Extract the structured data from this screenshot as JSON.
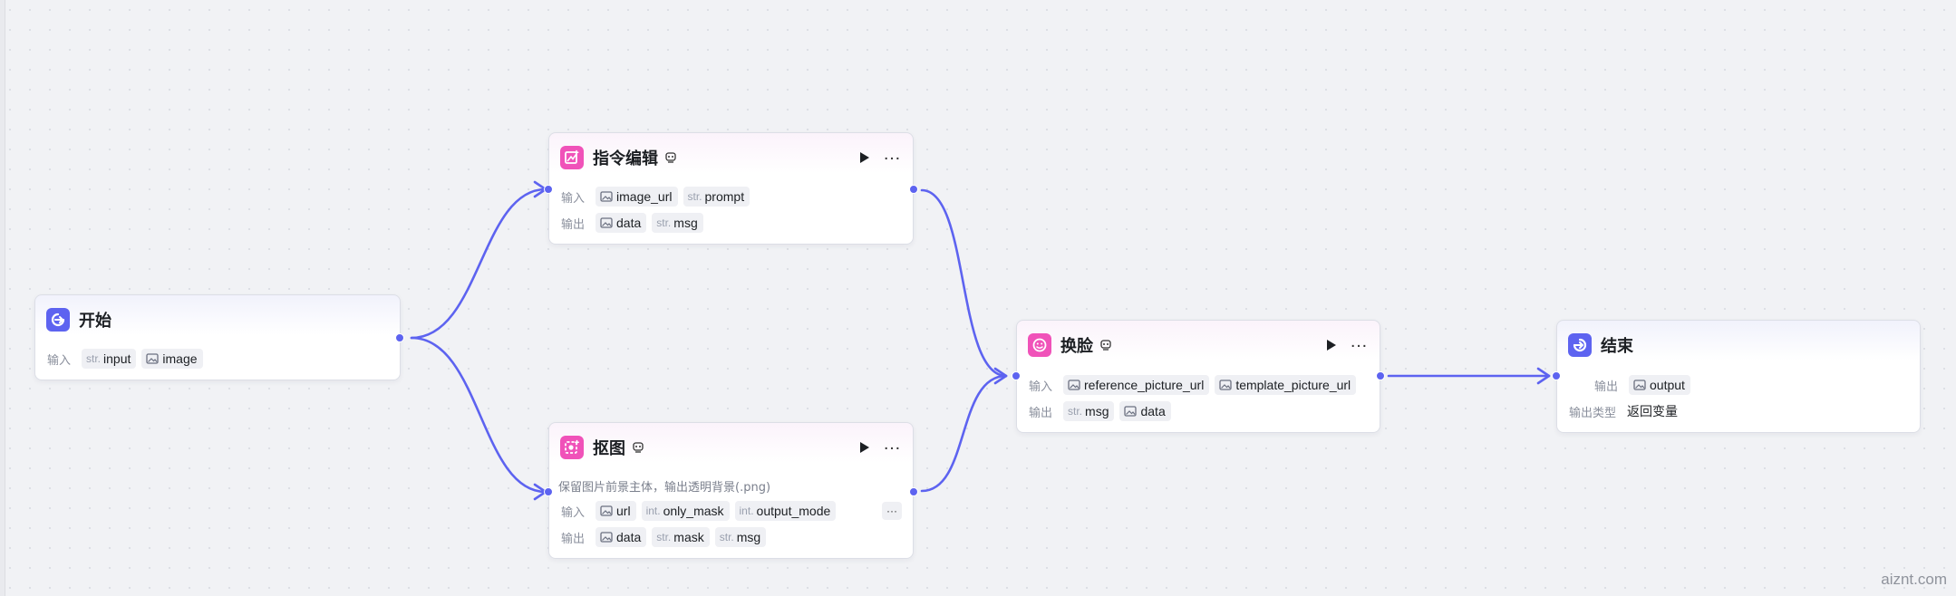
{
  "colors": {
    "accent": "#5d63f0",
    "pink_icon": "#f052b9",
    "canvas": "#f1f2f5"
  },
  "nodes": {
    "start": {
      "title": "开始",
      "icon": "start-icon",
      "input_label": "输入",
      "inputs": [
        {
          "type": "str.",
          "name": "input"
        },
        {
          "type": "image-icon",
          "name": "image"
        }
      ]
    },
    "instruct_edit": {
      "title": "指令编辑",
      "icon": "image-edit-icon",
      "input_label": "输入",
      "output_label": "输出",
      "inputs": [
        {
          "type": "image-icon",
          "name": "image_url"
        },
        {
          "type": "str.",
          "name": "prompt"
        }
      ],
      "outputs": [
        {
          "type": "image-icon",
          "name": "data"
        },
        {
          "type": "str.",
          "name": "msg"
        }
      ]
    },
    "cutout": {
      "title": "抠图",
      "icon": "cutout-icon",
      "description": "保留图片前景主体，输出透明背景(.png)",
      "input_label": "输入",
      "output_label": "输出",
      "inputs": [
        {
          "type": "image-icon",
          "name": "url"
        },
        {
          "type": "int.",
          "name": "only_mask"
        },
        {
          "type": "int.",
          "name": "output_mode"
        }
      ],
      "outputs": [
        {
          "type": "image-icon",
          "name": "data"
        },
        {
          "type": "str.",
          "name": "mask"
        },
        {
          "type": "str.",
          "name": "msg"
        }
      ],
      "more": "···"
    },
    "face_swap": {
      "title": "换脸",
      "icon": "face-icon",
      "input_label": "输入",
      "output_label": "输出",
      "inputs": [
        {
          "type": "image-icon",
          "name": "reference_picture_url"
        },
        {
          "type": "image-icon",
          "name": "template_picture_url"
        }
      ],
      "outputs": [
        {
          "type": "str.",
          "name": "msg"
        },
        {
          "type": "image-icon",
          "name": "data"
        }
      ]
    },
    "end": {
      "title": "结束",
      "icon": "end-icon",
      "output_label": "输出",
      "outputs": [
        {
          "type": "image-icon",
          "name": "output"
        }
      ],
      "output_type_label": "输出类型",
      "output_type_value": "返回变量"
    }
  },
  "watermark": "aiznt.com"
}
